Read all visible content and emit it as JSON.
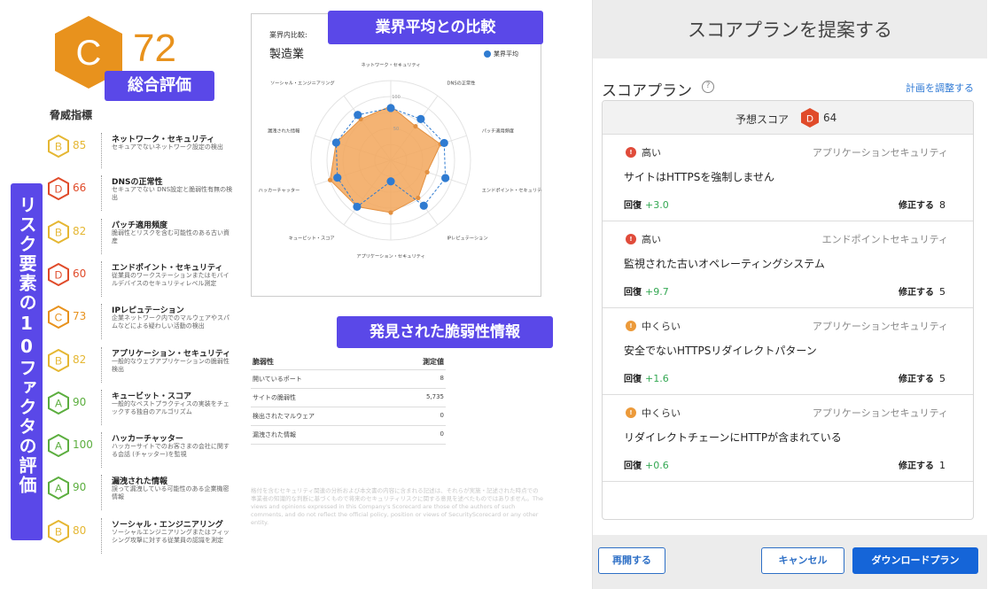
{
  "scorecard": {
    "overall_grade": "C",
    "overall_score": "72",
    "overall_tag": "総合評価",
    "threat_title": "脅威指標",
    "vertical_tag": "リスク要素の10ファクタの評価",
    "colors": {
      "A": "#5cae3f",
      "B": "#e5b733",
      "C": "#e8921d",
      "D": "#e04b2a",
      "tag": "#5a48e8"
    },
    "factors": [
      {
        "grade": "B",
        "score": "85",
        "name": "ネットワーク・セキュリティ",
        "desc": "セキュアでないネットワーク設定の検出"
      },
      {
        "grade": "D",
        "score": "66",
        "name": "DNSの正常性",
        "desc": "セキュアでない DNS設定と脆弱性有無の検出"
      },
      {
        "grade": "B",
        "score": "82",
        "name": "パッチ適用頻度",
        "desc": "脆弱性とリスクを含む可能性のある古い資産"
      },
      {
        "grade": "D",
        "score": "60",
        "name": "エンドポイント・セキュリティ",
        "desc": "従業員のワークステーションまたはモバイルデバイスのセキュリティレベル測定"
      },
      {
        "grade": "C",
        "score": "73",
        "name": "IPレピュテーション",
        "desc": "企業ネットワーク内でのマルウェアやスパムなどによる疑わしい活動の検出"
      },
      {
        "grade": "B",
        "score": "82",
        "name": "アプリケーション・セキュリティ",
        "desc": "一般的なウェブアプリケーションの脆弱性検出"
      },
      {
        "grade": "A",
        "score": "90",
        "name": "キュービット・スコア",
        "desc": "一般的なベストプラクティスの実装をチェックする独自のアルゴリズム"
      },
      {
        "grade": "A",
        "score": "100",
        "name": "ハッカーチャッター",
        "desc": "ハッカーサイトでのお客さまの会社に関する会話 (チャッター)を監視"
      },
      {
        "grade": "A",
        "score": "90",
        "name": "漏洩された情報",
        "desc": "誤って漏洩している可能性のある企業機密情報"
      },
      {
        "grade": "B",
        "score": "80",
        "name": "ソーシャル・エンジニアリング",
        "desc": "ソーシャルエンジニアリングまたはフィッシング攻撃に対する従業員の認識を測定"
      }
    ]
  },
  "comparison": {
    "tag": "業界平均との比較",
    "industry_label": "業界内比較:",
    "industry_value": "製造業",
    "legend": "業界平均",
    "tick_labels": [
      "100",
      "50"
    ]
  },
  "chart_data": {
    "type": "radar",
    "axes": [
      "ネットワーク・セキュリティ",
      "DNSの正常性",
      "パッチ適用頻度",
      "エンドポイント・セキュリティ",
      "IPレピュテーション",
      "アプリケーション・セキュリティ",
      "キュービット・スコア",
      "ハッカーチャッター",
      "漏洩された情報",
      "ソーシャル・エンジニアリング"
    ],
    "rmax": 100,
    "series": [
      {
        "name": "",
        "values": [
          85,
          66,
          82,
          60,
          73,
          82,
          90,
          100,
          90,
          80
        ],
        "color": "#f2a65a"
      },
      {
        "name": "業界平均",
        "values": [
          82,
          80,
          88,
          90,
          88,
          33,
          90,
          88,
          90,
          88
        ],
        "color": "#2f7bd1"
      }
    ]
  },
  "vulnerabilities": {
    "tag": "発見された脆弱性情報",
    "header": {
      "name": "脆弱性",
      "value": "測定値"
    },
    "rows": [
      {
        "name": "開いているポート",
        "value": "8"
      },
      {
        "name": "サイトの脆弱性",
        "value": "5,735"
      },
      {
        "name": "検出されたマルウェア",
        "value": "0"
      },
      {
        "name": "漏洩された情報",
        "value": "0"
      }
    ],
    "disclaimer": "格付を含むセキュリティ関連の分析および本文書の内容に含まれる記述は、それらが実施・記述された時点での事業者の知識的な判断に基づくもので将来のセキュリティリスクに関する意見を述べたものではありません。The views and opinions expressed in this Company's Scorecard are those of the authors of such comments, and do not reflect the official policy, position or views of SecurityScorecard or any other entity."
  },
  "dialog": {
    "title": "スコアプランを提案する",
    "plan_title": "スコアプラン",
    "help_icon": "?",
    "adjust_link": "計画を調整する",
    "predicted_label": "予想スコア",
    "predicted_grade": "D",
    "predicted_score": "64",
    "recovery_label": "回復",
    "fix_label": "修正する",
    "issues": [
      {
        "severity": "高い",
        "sev_level": "high",
        "sev_color": "#e04b3a",
        "category": "アプリケーションセキュリティ",
        "title": "サイトはHTTPSを強制しません",
        "recovery": "+3.0",
        "fix_count": "8"
      },
      {
        "severity": "高い",
        "sev_level": "high",
        "sev_color": "#e04b3a",
        "category": "エンドポイントセキュリティ",
        "title": "監視された古いオペレーティングシステム",
        "recovery": "+9.7",
        "fix_count": "5"
      },
      {
        "severity": "中くらい",
        "sev_level": "medium",
        "sev_color": "#ec9a3a",
        "category": "アプリケーションセキュリティ",
        "title": "安全でないHTTPSリダイレクトパターン",
        "recovery": "+1.6",
        "fix_count": "5"
      },
      {
        "severity": "中くらい",
        "sev_level": "medium",
        "sev_color": "#ec9a3a",
        "category": "アプリケーションセキュリティ",
        "title": "リダイレクトチェーンにHTTPが含まれている",
        "recovery": "+0.6",
        "fix_count": "1"
      }
    ],
    "buttons": {
      "reopen": "再開する",
      "cancel": "キャンセル",
      "download": "ダウンロードプラン"
    }
  }
}
